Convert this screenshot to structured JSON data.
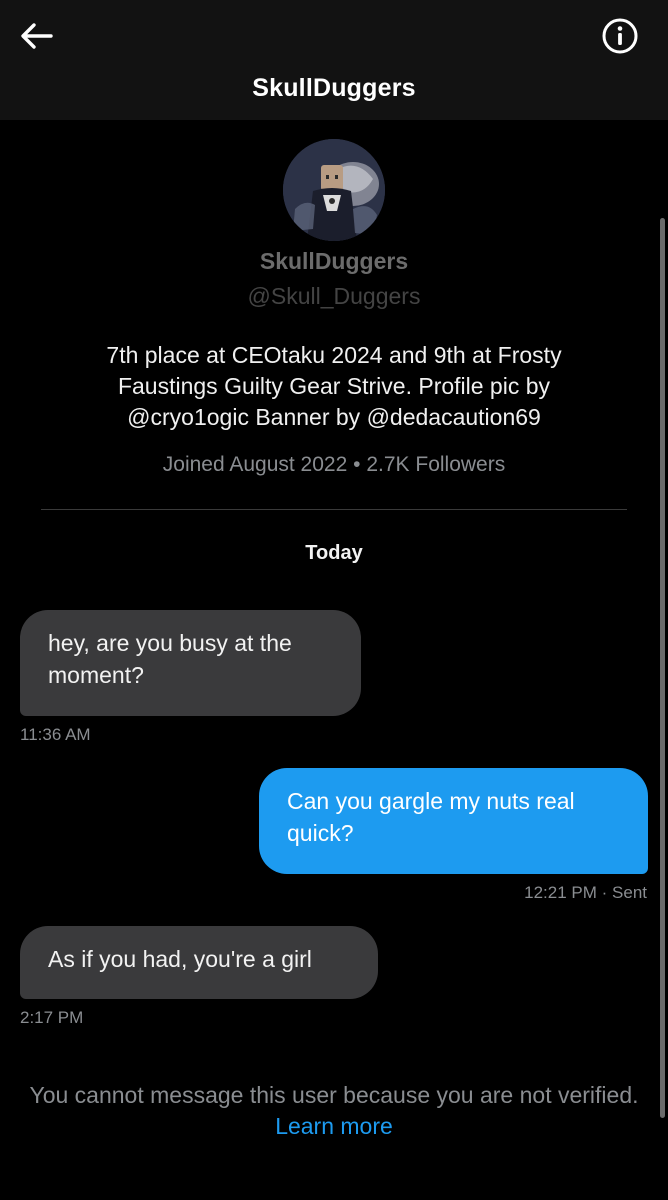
{
  "header": {
    "title": "SkullDuggers",
    "back_icon": "arrow-left-icon",
    "info_icon": "info-circle-icon"
  },
  "profile": {
    "name": "SkullDuggers",
    "handle": "@Skull_Duggers",
    "bio": "7th place at CEOtaku 2024 and 9th at Frosty Faustings Guilty Gear Strive. Profile pic by @cryo1ogic Banner by @dedacaution69",
    "joined": "Joined August 2022",
    "separator": "•",
    "followers": "2.7K Followers"
  },
  "conversation": {
    "date_label": "Today",
    "messages": [
      {
        "direction": "incoming",
        "text": "hey, are you busy at the moment?",
        "time": "11:36 AM"
      },
      {
        "direction": "outgoing",
        "text": "Can you gargle my nuts real quick?",
        "time": "12:21 PM",
        "status": "· Sent"
      },
      {
        "direction": "incoming",
        "text": "As if you had, you're a girl",
        "time": "2:17 PM"
      }
    ]
  },
  "footer": {
    "notice": "You cannot message this user because you are not verified.",
    "link": "Learn more"
  },
  "colors": {
    "background": "#000000",
    "header_background": "#121212",
    "incoming_bubble": "#3a3a3c",
    "outgoing_bubble": "#1d9bf0",
    "link": "#1d9bf0",
    "muted_text": "#8a8d91"
  }
}
